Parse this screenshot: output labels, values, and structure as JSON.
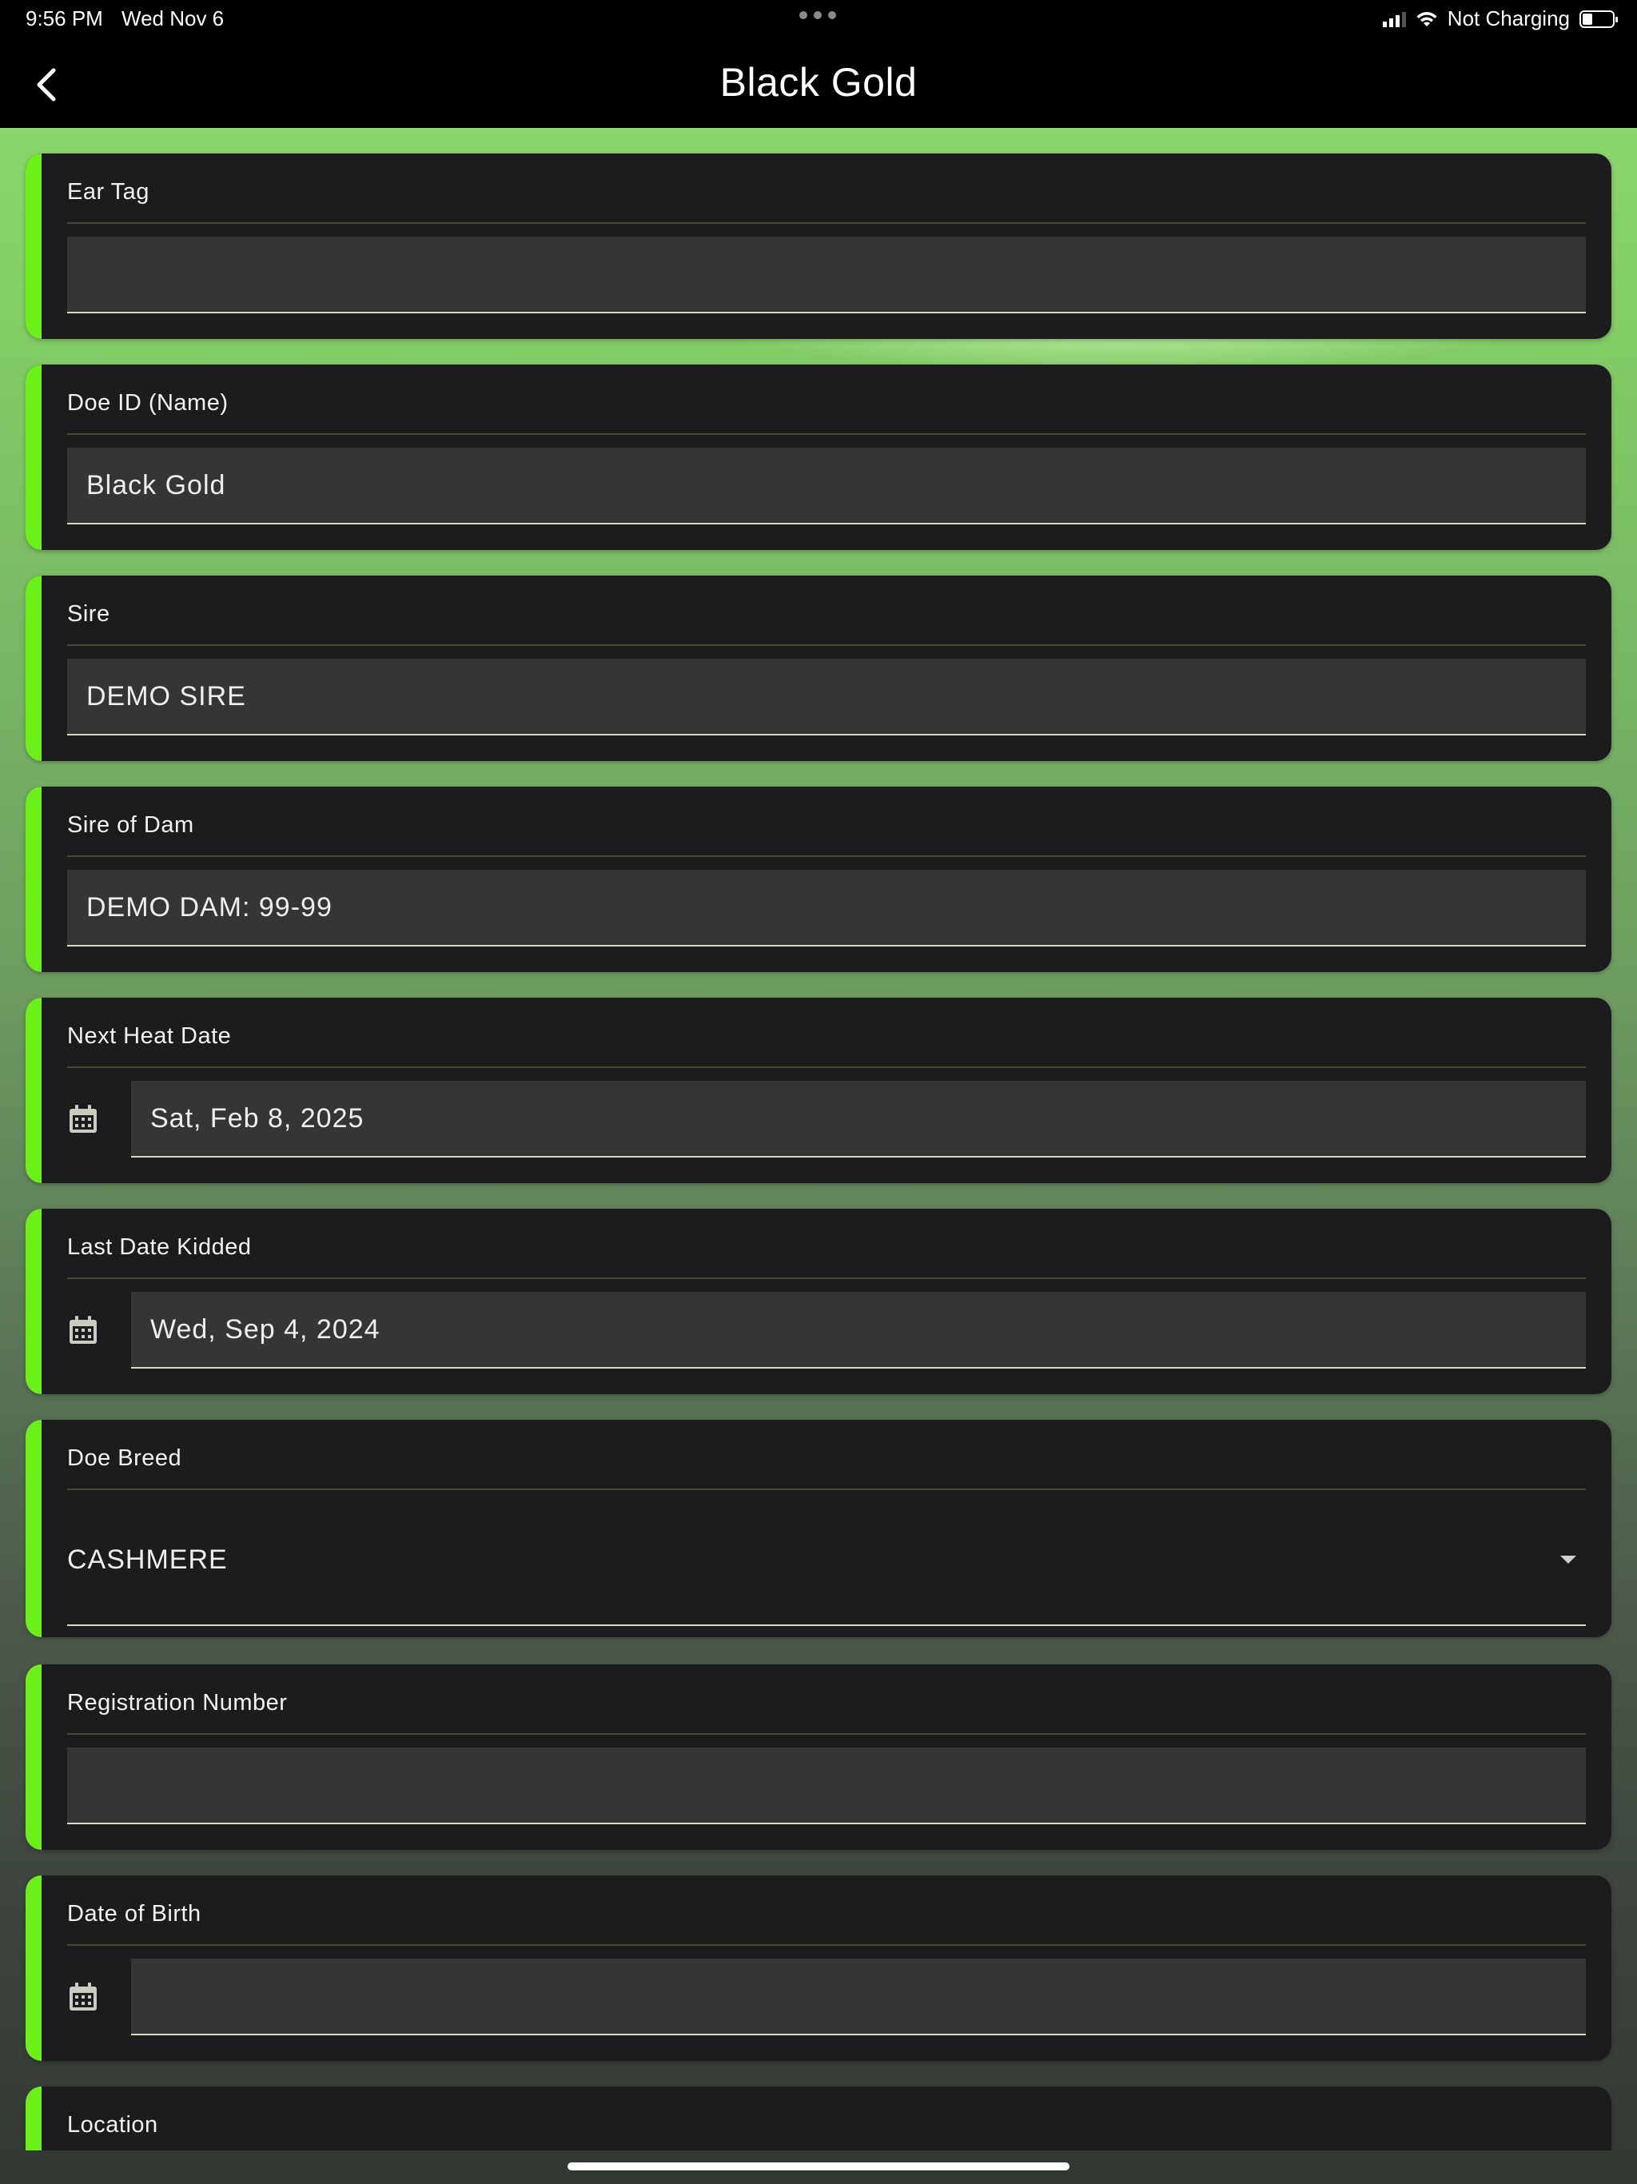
{
  "status_bar": {
    "time": "9:56 PM",
    "date": "Wed Nov 6",
    "battery_status": "Not Charging"
  },
  "nav": {
    "title": "Black Gold",
    "back_icon": "chevron-left-icon"
  },
  "accent_color": "#6bf018",
  "fields": {
    "ear_tag": {
      "label": "Ear Tag",
      "value": ""
    },
    "doe_id": {
      "label": "Doe ID (Name)",
      "value": "Black Gold"
    },
    "sire": {
      "label": "Sire",
      "value": "DEMO SIRE"
    },
    "sire_of_dam": {
      "label": "Sire of Dam",
      "value": "DEMO DAM: 99-99"
    },
    "next_heat_date": {
      "label": "Next Heat Date",
      "value": "Sat, Feb 8, 2025",
      "icon": "calendar-icon"
    },
    "last_date_kidded": {
      "label": "Last Date Kidded",
      "value": "Wed, Sep 4, 2024",
      "icon": "calendar-icon"
    },
    "doe_breed": {
      "label": "Doe Breed",
      "value": "CASHMERE",
      "icon": "dropdown-caret-icon"
    },
    "registration_number": {
      "label": "Registration Number",
      "value": ""
    },
    "date_of_birth": {
      "label": "Date of Birth",
      "value": "",
      "icon": "calendar-icon"
    },
    "location": {
      "label": "Location"
    }
  }
}
